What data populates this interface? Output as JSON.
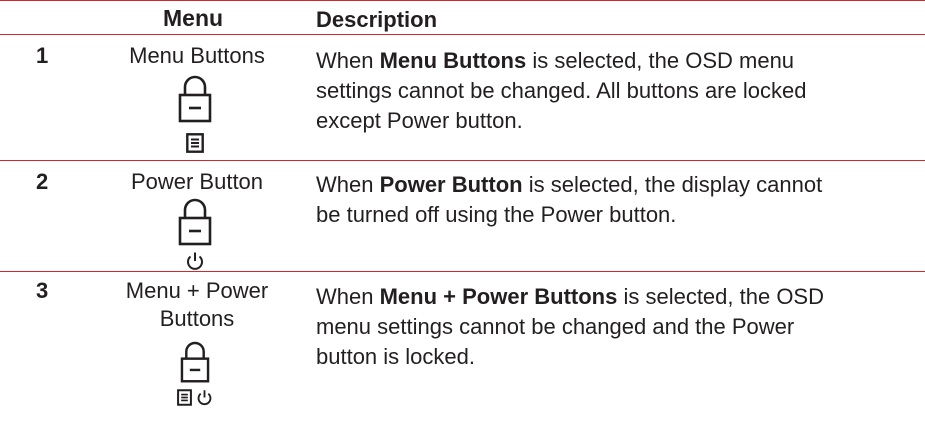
{
  "table": {
    "headers": {
      "menu": "Menu",
      "description": "Description"
    },
    "rows": [
      {
        "num": "1",
        "menu": "Menu Buttons",
        "desc_pre": "When ",
        "desc_bold": "Menu Buttons",
        "desc_post_lines": [
          " is selected, the OSD menu",
          "settings cannot be changed. All buttons are locked",
          "except Power button."
        ],
        "icons": [
          "lock-icon",
          "menu-icon"
        ]
      },
      {
        "num": "2",
        "menu": "Power Button",
        "desc_pre": "When ",
        "desc_bold": "Power Button",
        "desc_post_lines": [
          " is selected, the display cannot",
          "be turned off using the Power button."
        ],
        "icons": [
          "lock-icon",
          "power-icon"
        ]
      },
      {
        "num": "3",
        "menu_lines": [
          "Menu + Power",
          "Buttons"
        ],
        "desc_pre": "When ",
        "desc_bold": "Menu + Power Buttons",
        "desc_post_lines": [
          " is selected, the OSD",
          "menu settings cannot be changed and the Power",
          "button is locked."
        ],
        "icons": [
          "lock-icon",
          "menu-icon",
          "power-icon"
        ]
      }
    ],
    "accent_color": "#d2282e"
  }
}
